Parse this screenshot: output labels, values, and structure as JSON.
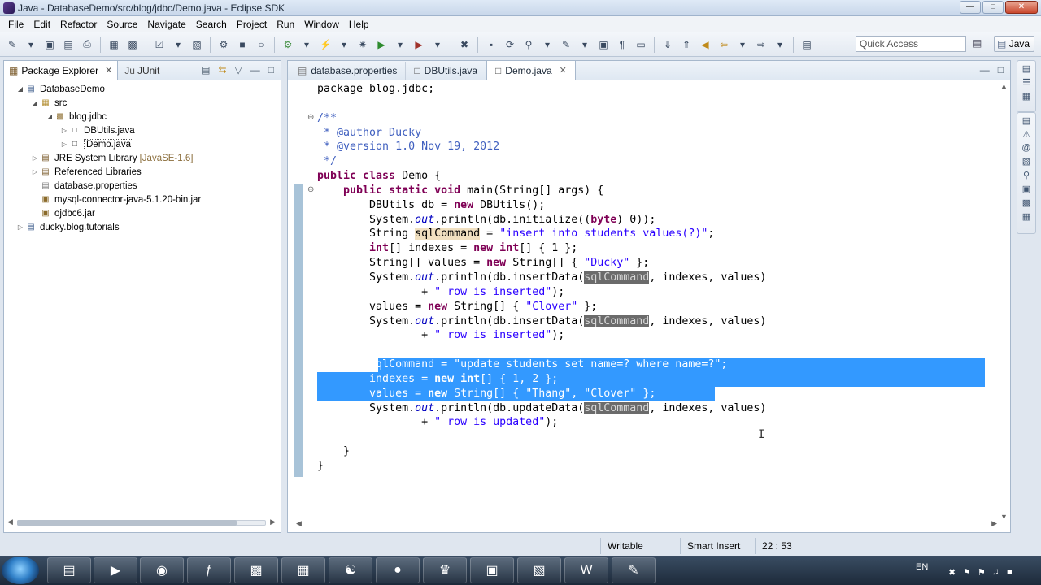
{
  "window": {
    "title": "Java - DatabaseDemo/src/blog/jdbc/Demo.java - Eclipse SDK"
  },
  "menu": [
    "File",
    "Edit",
    "Refactor",
    "Source",
    "Navigate",
    "Search",
    "Project",
    "Run",
    "Window",
    "Help"
  ],
  "toolbar": {
    "quick_access_placeholder": "Quick Access",
    "perspective": "Java"
  },
  "package_explorer": {
    "tab_label": "Package Explorer",
    "junit_tab": "JUnit",
    "junit_prefix": "Ju",
    "tree": [
      {
        "label": "DatabaseDemo",
        "depth": 0,
        "arrow": "expanded",
        "icon": "project-icon"
      },
      {
        "label": "src",
        "depth": 1,
        "arrow": "expanded",
        "icon": "source-folder-icon"
      },
      {
        "label": "blog.jdbc",
        "depth": 2,
        "arrow": "expanded",
        "icon": "package-icon"
      },
      {
        "label": "DBUtils.java",
        "depth": 3,
        "arrow": "collapsed",
        "icon": "java-file-icon"
      },
      {
        "label": "Demo.java",
        "depth": 3,
        "arrow": "collapsed",
        "icon": "java-file-icon",
        "selected": true
      },
      {
        "label": "JRE System Library",
        "decoration": "[JavaSE-1.6]",
        "depth": 1,
        "arrow": "collapsed",
        "icon": "library-icon"
      },
      {
        "label": "Referenced Libraries",
        "depth": 1,
        "arrow": "collapsed",
        "icon": "library-icon"
      },
      {
        "label": "database.properties",
        "depth": 1,
        "arrow": "none",
        "icon": "properties-file-icon"
      },
      {
        "label": "mysql-connector-java-5.1.20-bin.jar",
        "depth": 1,
        "arrow": "none",
        "icon": "jar-icon"
      },
      {
        "label": "ojdbc6.jar",
        "depth": 1,
        "arrow": "none",
        "icon": "jar-icon"
      },
      {
        "label": "ducky.blog.tutorials",
        "depth": 0,
        "arrow": "collapsed",
        "icon": "project-icon"
      }
    ]
  },
  "editor": {
    "tabs": [
      {
        "label": "database.properties",
        "active": false
      },
      {
        "label": "DBUtils.java",
        "active": false
      },
      {
        "label": "Demo.java",
        "active": true
      }
    ],
    "code": [
      {
        "indent": 0,
        "tokens": [
          {
            "t": "package blog.jdbc;",
            "c": "plain"
          }
        ]
      },
      {
        "indent": 0,
        "tokens": []
      },
      {
        "indent": 0,
        "fold": true,
        "tokens": [
          {
            "t": "/**",
            "c": "cm"
          }
        ]
      },
      {
        "indent": 0,
        "tokens": [
          {
            "t": " * @author Ducky",
            "c": "cm"
          }
        ]
      },
      {
        "indent": 0,
        "tokens": [
          {
            "t": " * @version 1.0 Nov 19, 2012",
            "c": "cm"
          }
        ]
      },
      {
        "indent": 0,
        "tokens": [
          {
            "t": " */",
            "c": "cm"
          }
        ]
      },
      {
        "indent": 0,
        "tokens": [
          {
            "t": "public class ",
            "c": "kw"
          },
          {
            "t": "Demo {",
            "c": "plain"
          }
        ]
      },
      {
        "indent": 1,
        "fold": true,
        "tokens": [
          {
            "t": "public static void ",
            "c": "kw"
          },
          {
            "t": "main(String[] args) {",
            "c": "plain"
          }
        ]
      },
      {
        "indent": 2,
        "tokens": [
          {
            "t": "DBUtils db = ",
            "c": "plain"
          },
          {
            "t": "new ",
            "c": "kw"
          },
          {
            "t": "DBUtils();",
            "c": "plain"
          }
        ]
      },
      {
        "indent": 2,
        "tokens": [
          {
            "t": "System.",
            "c": "plain"
          },
          {
            "t": "out",
            "c": "it"
          },
          {
            "t": ".println(db.initialize((",
            "c": "plain"
          },
          {
            "t": "byte",
            "c": "kw"
          },
          {
            "t": ") 0));",
            "c": "plain"
          }
        ]
      },
      {
        "indent": 2,
        "tokens": [
          {
            "t": "String ",
            "c": "plain"
          },
          {
            "t": "sqlCommand",
            "c": "hlv"
          },
          {
            "t": " = ",
            "c": "plain"
          },
          {
            "t": "\"insert into students values(?)\"",
            "c": "str"
          },
          {
            "t": ";",
            "c": "plain"
          }
        ]
      },
      {
        "indent": 2,
        "tokens": [
          {
            "t": "int",
            "c": "kw"
          },
          {
            "t": "[] indexes = ",
            "c": "plain"
          },
          {
            "t": "new int",
            "c": "kw"
          },
          {
            "t": "[] { 1 };",
            "c": "plain"
          }
        ]
      },
      {
        "indent": 2,
        "tokens": [
          {
            "t": "String[] values = ",
            "c": "plain"
          },
          {
            "t": "new ",
            "c": "kw"
          },
          {
            "t": "String[] { ",
            "c": "plain"
          },
          {
            "t": "\"Ducky\"",
            "c": "str"
          },
          {
            "t": " };",
            "c": "plain"
          }
        ]
      },
      {
        "indent": 2,
        "tokens": [
          {
            "t": "System.",
            "c": "plain"
          },
          {
            "t": "out",
            "c": "it"
          },
          {
            "t": ".println(db.insertData(",
            "c": "plain"
          },
          {
            "t": "sqlCommand",
            "c": "occ"
          },
          {
            "t": ", indexes, values)",
            "c": "plain"
          }
        ]
      },
      {
        "indent": 4,
        "tokens": [
          {
            "t": "+ ",
            "c": "plain"
          },
          {
            "t": "\" row is inserted\"",
            "c": "str"
          },
          {
            "t": ");",
            "c": "plain"
          }
        ]
      },
      {
        "indent": 2,
        "tokens": [
          {
            "t": "values = ",
            "c": "plain"
          },
          {
            "t": "new ",
            "c": "kw"
          },
          {
            "t": "String[] { ",
            "c": "plain"
          },
          {
            "t": "\"Clover\"",
            "c": "str"
          },
          {
            "t": " };",
            "c": "plain"
          }
        ]
      },
      {
        "indent": 2,
        "tokens": [
          {
            "t": "System.",
            "c": "plain"
          },
          {
            "t": "out",
            "c": "it"
          },
          {
            "t": ".println(db.insertData(",
            "c": "plain"
          },
          {
            "t": "sqlCommand",
            "c": "occ"
          },
          {
            "t": ", indexes, values)",
            "c": "plain"
          }
        ]
      },
      {
        "indent": 4,
        "tokens": [
          {
            "t": "+ ",
            "c": "plain"
          },
          {
            "t": "\" row is inserted\"",
            "c": "str"
          },
          {
            "t": ");",
            "c": "plain"
          }
        ]
      },
      {
        "indent": 0,
        "tokens": []
      },
      {
        "indent": 2,
        "selected": true,
        "tokens": [
          {
            "t": "sqlCommand = ",
            "c": "plain"
          },
          {
            "t": "\"update students set name=? where name=?\"",
            "c": "str"
          },
          {
            "t": ";",
            "c": "plain"
          }
        ]
      },
      {
        "indent": 2,
        "selected": true,
        "tokens": [
          {
            "t": "indexes = ",
            "c": "plain"
          },
          {
            "t": "new int",
            "c": "kw"
          },
          {
            "t": "[] { 1, 2 };",
            "c": "plain"
          }
        ]
      },
      {
        "indent": 2,
        "selected": true,
        "tokens": [
          {
            "t": "values = ",
            "c": "plain"
          },
          {
            "t": "new ",
            "c": "kw"
          },
          {
            "t": "String[] { ",
            "c": "plain"
          },
          {
            "t": "\"Thang\"",
            "c": "str"
          },
          {
            "t": ", ",
            "c": "plain"
          },
          {
            "t": "\"Clover\"",
            "c": "str"
          },
          {
            "t": " };",
            "c": "plain"
          }
        ]
      },
      {
        "indent": 2,
        "tokens": [
          {
            "t": "System.",
            "c": "plain"
          },
          {
            "t": "out",
            "c": "it"
          },
          {
            "t": ".println(db.updateData(",
            "c": "plain"
          },
          {
            "t": "sqlCommand",
            "c": "occ"
          },
          {
            "t": ", indexes, values)",
            "c": "plain"
          }
        ]
      },
      {
        "indent": 4,
        "tokens": [
          {
            "t": "+ ",
            "c": "plain"
          },
          {
            "t": "\" row is updated\"",
            "c": "str"
          },
          {
            "t": ");",
            "c": "plain"
          }
        ]
      },
      {
        "indent": 0,
        "tokens": []
      },
      {
        "indent": 1,
        "tokens": [
          {
            "t": "}",
            "c": "plain"
          }
        ]
      },
      {
        "indent": 0,
        "tokens": [
          {
            "t": "}",
            "c": "plain"
          }
        ]
      }
    ]
  },
  "status": {
    "writable": "Writable",
    "insert_mode": "Smart Insert",
    "position": "22 : 53"
  },
  "tray": {
    "language": "EN"
  },
  "colors": {
    "selection": "#3399ff",
    "keyword": "#7f0055",
    "string": "#2a00ff",
    "comment": "#3f5fbf"
  }
}
